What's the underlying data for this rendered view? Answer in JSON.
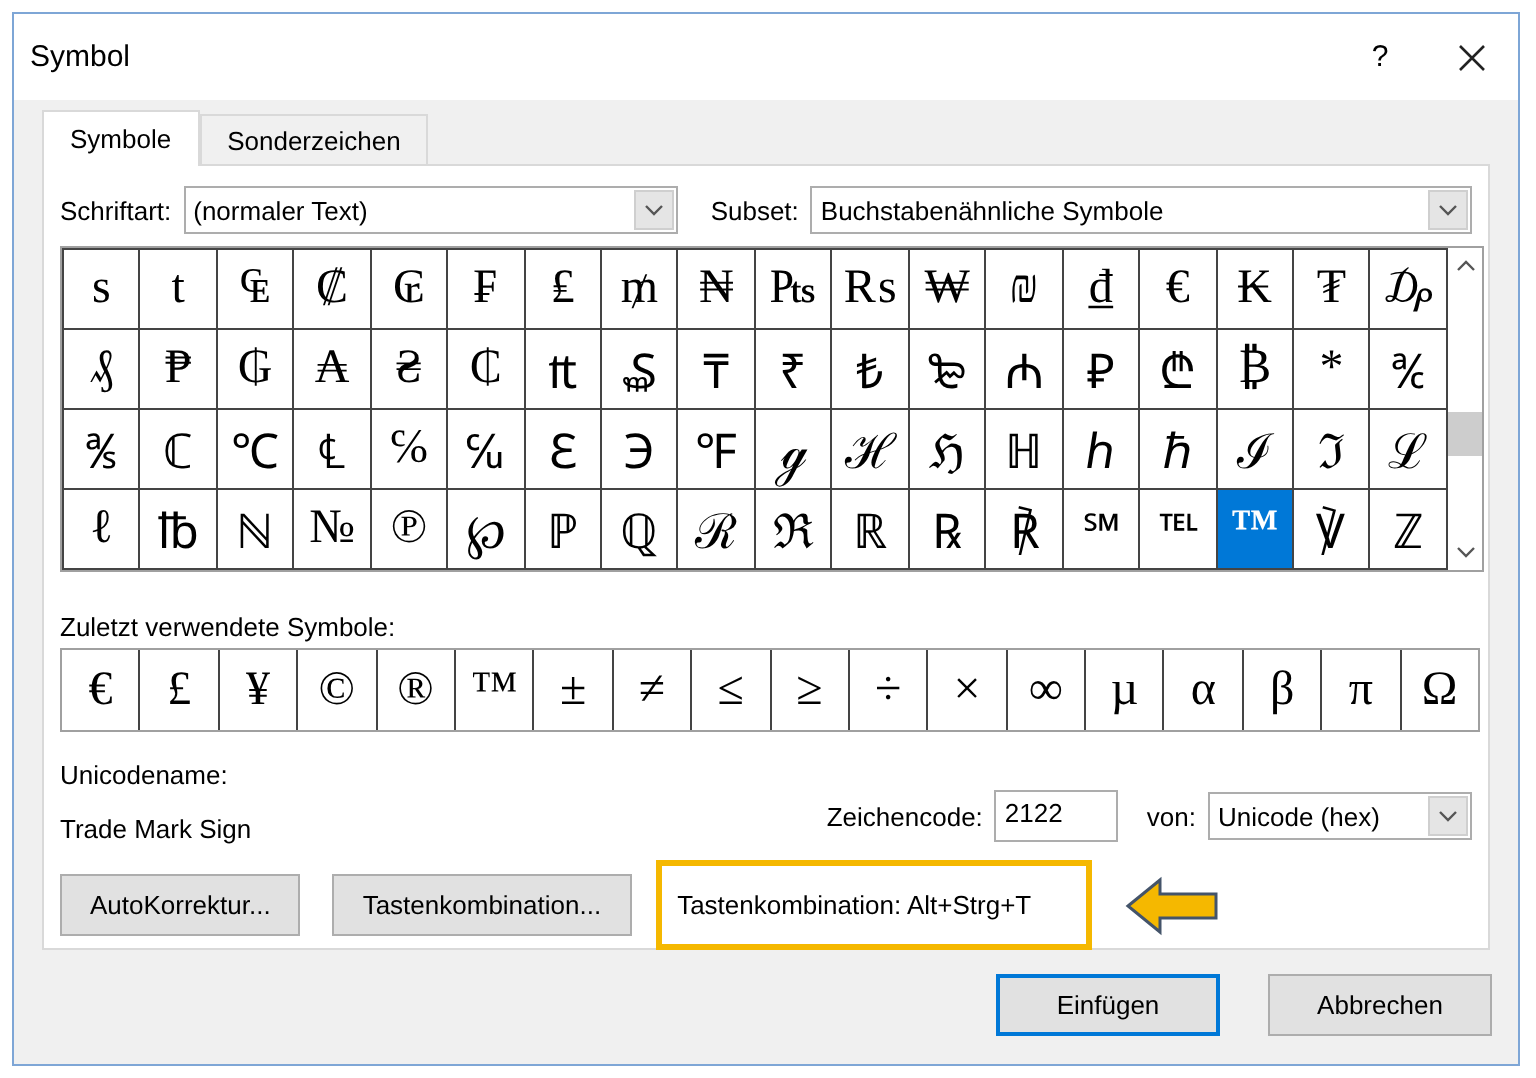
{
  "window": {
    "title": "Symbol",
    "help": "?"
  },
  "tabs": [
    {
      "label": "Symbole",
      "selected": true
    },
    {
      "label": "Sonderzeichen",
      "selected": false
    }
  ],
  "font_field": {
    "label": "Schriftart:",
    "value": "(normaler Text)"
  },
  "subset_field": {
    "label": "Subset:",
    "value": "Buchstabenähnliche Symbole"
  },
  "symbol_grid": {
    "rows": [
      [
        {
          "char": "s",
          "selected": false
        },
        {
          "char": "t",
          "selected": false
        },
        {
          "char": "₠",
          "selected": false
        },
        {
          "char": "₡",
          "selected": false
        },
        {
          "char": "₢",
          "selected": false
        },
        {
          "char": "₣",
          "selected": false
        },
        {
          "char": "₤",
          "selected": false
        },
        {
          "char": "₥",
          "selected": false
        },
        {
          "char": "₦",
          "selected": false
        },
        {
          "char": "₧",
          "selected": false
        },
        {
          "char": "₨",
          "selected": false
        },
        {
          "char": "₩",
          "selected": false
        },
        {
          "char": "₪",
          "selected": false
        },
        {
          "char": "₫",
          "selected": false
        },
        {
          "char": "€",
          "selected": false
        },
        {
          "char": "₭",
          "selected": false
        },
        {
          "char": "₮",
          "selected": false
        },
        {
          "char": "₯",
          "selected": false
        }
      ],
      [
        {
          "char": "₰",
          "selected": false
        },
        {
          "char": "₱",
          "selected": false
        },
        {
          "char": "₲",
          "selected": false
        },
        {
          "char": "₳",
          "selected": false
        },
        {
          "char": "₴",
          "selected": false
        },
        {
          "char": "₵",
          "selected": false
        },
        {
          "char": "₶",
          "selected": false
        },
        {
          "char": "₷",
          "selected": false
        },
        {
          "char": "₸",
          "selected": false
        },
        {
          "char": "₹",
          "selected": false
        },
        {
          "char": "₺",
          "selected": false
        },
        {
          "char": "₻",
          "selected": false
        },
        {
          "char": "₼",
          "selected": false
        },
        {
          "char": "₽",
          "selected": false
        },
        {
          "char": "₾",
          "selected": false
        },
        {
          "char": "₿",
          "selected": false
        },
        {
          "char": "*",
          "selected": false
        },
        {
          "char": "℀",
          "selected": false
        }
      ],
      [
        {
          "char": "℁",
          "selected": false
        },
        {
          "char": "ℂ",
          "selected": false
        },
        {
          "char": "℃",
          "selected": false
        },
        {
          "char": "℄",
          "selected": false
        },
        {
          "char": "℅",
          "selected": false
        },
        {
          "char": "℆",
          "selected": false
        },
        {
          "char": "ℇ",
          "selected": false
        },
        {
          "char": "℈",
          "selected": false
        },
        {
          "char": "℉",
          "selected": false
        },
        {
          "char": "ℊ",
          "selected": false
        },
        {
          "char": "ℋ",
          "selected": false
        },
        {
          "char": "ℌ",
          "selected": false
        },
        {
          "char": "ℍ",
          "selected": false
        },
        {
          "char": "ℎ",
          "selected": false
        },
        {
          "char": "ℏ",
          "selected": false
        },
        {
          "char": "ℐ",
          "selected": false
        },
        {
          "char": "ℑ",
          "selected": false
        },
        {
          "char": "ℒ",
          "selected": false
        }
      ],
      [
        {
          "char": "ℓ",
          "selected": false
        },
        {
          "char": "℔",
          "selected": false
        },
        {
          "char": "ℕ",
          "selected": false
        },
        {
          "char": "№",
          "selected": false
        },
        {
          "char": "℗",
          "selected": false
        },
        {
          "char": "℘",
          "selected": false
        },
        {
          "char": "ℙ",
          "selected": false
        },
        {
          "char": "ℚ",
          "selected": false
        },
        {
          "char": "ℛ",
          "selected": false
        },
        {
          "char": "ℜ",
          "selected": false
        },
        {
          "char": "ℝ",
          "selected": false
        },
        {
          "char": "℞",
          "selected": false
        },
        {
          "char": "℟",
          "selected": false
        },
        {
          "char": "℠",
          "selected": false
        },
        {
          "char": "℡",
          "selected": false
        },
        {
          "char": "™",
          "selected": true
        },
        {
          "char": "℣",
          "selected": false
        },
        {
          "char": "ℤ",
          "selected": false
        }
      ]
    ]
  },
  "recent": {
    "label": "Zuletzt verwendete Symbole:",
    "symbols": [
      "€",
      "£",
      "¥",
      "©",
      "®",
      "™",
      "±",
      "≠",
      "≤",
      "≥",
      "÷",
      "×",
      "∞",
      "µ",
      "α",
      "β",
      "π",
      "Ω"
    ]
  },
  "unicode_name": {
    "label": "Unicodename:",
    "value": "Trade Mark Sign"
  },
  "char_code": {
    "label": "Zeichencode:",
    "value": "2122"
  },
  "from_field": {
    "label": "von:",
    "value": "Unicode (hex)"
  },
  "action_buttons": [
    "AutoKorrektur...",
    "Tastenkombination..."
  ],
  "shortcut_info": "Tastenkombination: Alt+Strg+T",
  "dialog_buttons": [
    {
      "label": "Einfügen",
      "default": true
    },
    {
      "label": "Abbrechen",
      "default": false
    }
  ]
}
